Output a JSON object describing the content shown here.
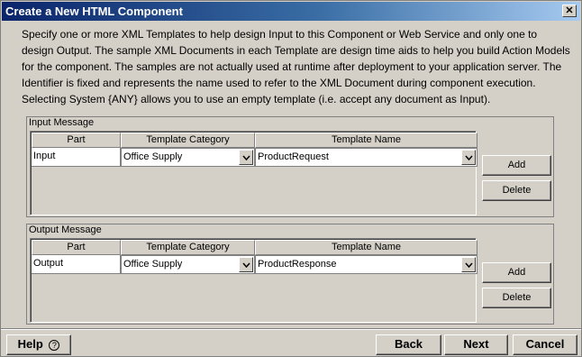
{
  "window": {
    "title": "Create a New HTML Component",
    "close_label": "✕"
  },
  "description": "Specify one or more XML Templates to help design Input to this Component or Web Service and only one to design Output.  The sample XML Documents in each Template are design time aids to help you build Action Models for the component.  The samples are not actually used at runtime after deployment to your application server.  The Identifier is fixed and represents the name used to refer to the XML Document during component execution.  Selecting System {ANY} allows you to use an empty template (i.e. accept any document as Input).",
  "input_message": {
    "title": "Input Message",
    "columns": [
      "Part",
      "Template Category",
      "Template Name"
    ],
    "row": {
      "part": "Input",
      "category": "Office Supply",
      "template": "ProductRequest"
    },
    "add_label": "Add",
    "delete_label": "Delete"
  },
  "output_message": {
    "title": "Output Message",
    "columns": [
      "Part",
      "Template Category",
      "Template Name"
    ],
    "row": {
      "part": "Output",
      "category": "Office Supply",
      "template": "ProductResponse"
    },
    "add_label": "Add",
    "delete_label": "Delete"
  },
  "footer": {
    "help_label": "Help",
    "help_icon": "?",
    "back_label": "Back",
    "next_label": "Next",
    "cancel_label": "Cancel"
  },
  "colors": {
    "title_bar_start": "#0a246a",
    "title_bar_end": "#a6caf0",
    "dialog_background": "#d4d0c8"
  }
}
